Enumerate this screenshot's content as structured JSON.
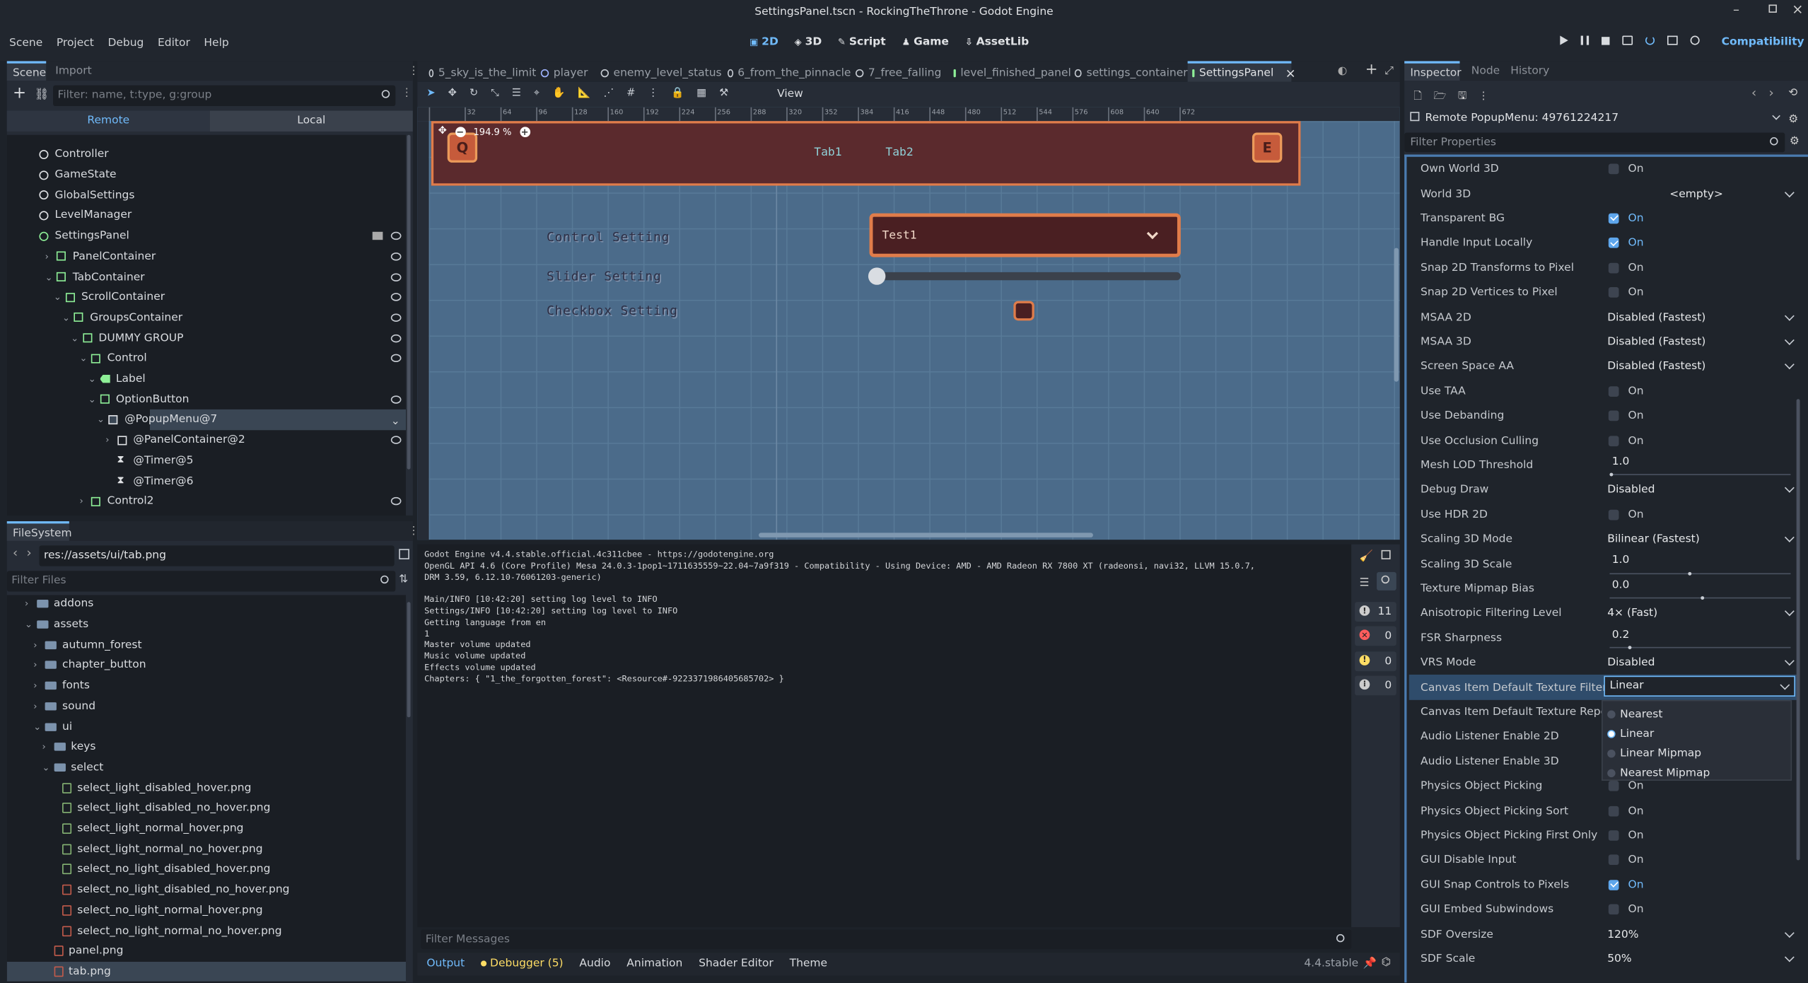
{
  "window": {
    "title": "SettingsPanel.tscn - RockingTheThrone - Godot Engine"
  },
  "menu": [
    "Scene",
    "Project",
    "Debug",
    "Editor",
    "Help"
  ],
  "workspaces": [
    "2D",
    "3D",
    "Script",
    "Game",
    "AssetLib"
  ],
  "renderer": "Compatibility",
  "scene_dock": {
    "tabs": [
      "Scene",
      "Import"
    ],
    "filter_placeholder": "Filter: name, t:type, g:group",
    "remote_local": [
      "Remote",
      "Local"
    ],
    "nodes": [
      {
        "label": "Controller",
        "indent": 1
      },
      {
        "label": "GameState",
        "indent": 1
      },
      {
        "label": "GlobalSettings",
        "indent": 1
      },
      {
        "label": "LevelManager",
        "indent": 1
      },
      {
        "label": "SettingsPanel",
        "indent": 1
      },
      {
        "label": "PanelContainer",
        "indent": 2
      },
      {
        "label": "TabContainer",
        "indent": 2
      },
      {
        "label": "ScrollContainer",
        "indent": 3
      },
      {
        "label": "GroupsContainer",
        "indent": 4
      },
      {
        "label": "DUMMY GROUP",
        "indent": 5
      },
      {
        "label": "Control",
        "indent": 6
      },
      {
        "label": "Label",
        "indent": 7
      },
      {
        "label": "OptionButton",
        "indent": 7
      },
      {
        "label": "@PopupMenu@7",
        "indent": 8
      },
      {
        "label": "@PanelContainer@2",
        "indent": 9
      },
      {
        "label": "@Timer@5",
        "indent": 9
      },
      {
        "label": "@Timer@6",
        "indent": 9
      },
      {
        "label": "Control2",
        "indent": 6
      }
    ]
  },
  "filesystem": {
    "tab": "FileSystem",
    "path": "res://assets/ui/tab.png",
    "filter_placeholder": "Filter Files",
    "items": [
      {
        "label": "addons",
        "type": "folder",
        "indent": 1
      },
      {
        "label": "assets",
        "type": "folder",
        "indent": 1
      },
      {
        "label": "autumn_forest",
        "type": "folder",
        "indent": 2
      },
      {
        "label": "chapter_button",
        "type": "folder",
        "indent": 2
      },
      {
        "label": "fonts",
        "type": "folder",
        "indent": 2
      },
      {
        "label": "sound",
        "type": "folder",
        "indent": 2
      },
      {
        "label": "ui",
        "type": "folder",
        "indent": 2
      },
      {
        "label": "keys",
        "type": "folder",
        "indent": 3
      },
      {
        "label": "select",
        "type": "folder",
        "indent": 3
      },
      {
        "label": "select_light_disabled_hover.png",
        "type": "file",
        "indent": 4
      },
      {
        "label": "select_light_disabled_no_hover.png",
        "type": "file",
        "indent": 4
      },
      {
        "label": "select_light_normal_hover.png",
        "type": "file",
        "indent": 4
      },
      {
        "label": "select_light_normal_no_hover.png",
        "type": "file",
        "indent": 4
      },
      {
        "label": "select_no_light_disabled_hover.png",
        "type": "file",
        "indent": 4
      },
      {
        "label": "select_no_light_disabled_no_hover.png",
        "type": "file-red",
        "indent": 4
      },
      {
        "label": "select_no_light_normal_hover.png",
        "type": "file-red",
        "indent": 4
      },
      {
        "label": "select_no_light_normal_no_hover.png",
        "type": "file-red",
        "indent": 4
      },
      {
        "label": "panel.png",
        "type": "file-red",
        "indent": 3
      },
      {
        "label": "tab.png",
        "type": "file-red",
        "indent": 3
      }
    ]
  },
  "scene_tabs": [
    "5_sky_is_the_limit",
    "player",
    "enemy_level_status",
    "6_from_the_pinnacle",
    "7_free_falling",
    "level_finished_panel",
    "settings_container",
    "SettingsPanel"
  ],
  "viewport": {
    "view_label": "View",
    "zoom": "194.9 %",
    "ruler": [
      "-",
      "32",
      "64",
      "96",
      "128",
      "160",
      "192",
      "224",
      "256",
      "288",
      "320",
      "352",
      "384",
      "416",
      "448",
      "480",
      "512",
      "544",
      "576",
      "608",
      "640",
      "672"
    ],
    "tabs": [
      "Tab1",
      "Tab2"
    ],
    "key_left": "Q",
    "key_right": "E",
    "settings": [
      "Control Setting",
      "Slider Setting",
      "Checkbox Setting"
    ],
    "option_value": "Test1"
  },
  "console": {
    "lines": [
      "Godot Engine v4.4.stable.official.4c311cbee - https://godotengine.org",
      "OpenGL API 4.6 (Core Profile) Mesa 24.0.3-1pop1~1711635559~22.04~7a9f319 - Compatibility - Using Device: AMD - AMD Radeon RX 7800 XT (radeonsi, navi32, LLVM 15.0.7,",
      "DRM 3.59, 6.12.10-76061203-generic)",
      "",
      "Main/INFO [10:42:20] setting log level to INFO",
      "Settings/INFO [10:42:20] setting log level to INFO",
      "Getting language from en",
      "1",
      "Master volume updated",
      "Music volume updated",
      "Effects volume updated",
      "Chapters: { \"1_the_forgotten_forest\": <Resource#-9223371986405685702> }"
    ],
    "counts": [
      "11",
      "0",
      "0",
      "0"
    ],
    "filter_placeholder": "Filter Messages"
  },
  "bottom_tabs": [
    "Output",
    "Debugger (5)",
    "Audio",
    "Animation",
    "Shader Editor",
    "Theme"
  ],
  "version": "4.4.stable",
  "inspector": {
    "tabs": [
      "Inspector",
      "Node",
      "History"
    ],
    "object": "Remote PopupMenu: 49761224217",
    "filter_placeholder": "Filter Properties",
    "props": [
      {
        "label": "Own World 3D",
        "kind": "check",
        "on": false,
        "value": "On"
      },
      {
        "label": "World 3D",
        "kind": "res",
        "value": "<empty>"
      },
      {
        "label": "Transparent BG",
        "kind": "check",
        "on": true,
        "value": "On"
      },
      {
        "label": "Handle Input Locally",
        "kind": "check",
        "on": true,
        "value": "On"
      },
      {
        "label": "Snap 2D Transforms to Pixel",
        "kind": "check",
        "on": false,
        "value": "On"
      },
      {
        "label": "Snap 2D Vertices to Pixel",
        "kind": "check",
        "on": false,
        "value": "On"
      },
      {
        "label": "MSAA 2D",
        "kind": "dd",
        "value": "Disabled (Fastest)"
      },
      {
        "label": "MSAA 3D",
        "kind": "dd",
        "value": "Disabled (Fastest)"
      },
      {
        "label": "Screen Space AA",
        "kind": "dd",
        "value": "Disabled (Fastest)"
      },
      {
        "label": "Use TAA",
        "kind": "check",
        "on": false,
        "value": "On"
      },
      {
        "label": "Use Debanding",
        "kind": "check",
        "on": false,
        "value": "On"
      },
      {
        "label": "Use Occlusion Culling",
        "kind": "check",
        "on": false,
        "value": "On"
      },
      {
        "label": "Mesh LOD Threshold",
        "kind": "slider",
        "value": "1.0",
        "fill": 0.0
      },
      {
        "label": "Debug Draw",
        "kind": "dd",
        "value": "Disabled"
      },
      {
        "label": "Use HDR 2D",
        "kind": "check",
        "on": false,
        "value": "On"
      },
      {
        "label": "Scaling 3D Mode",
        "kind": "dd",
        "value": "Bilinear (Fastest)"
      },
      {
        "label": "Scaling 3D Scale",
        "kind": "slider",
        "value": "1.0",
        "fill": 0.43
      },
      {
        "label": "Texture Mipmap Bias",
        "kind": "slider",
        "value": "0.0",
        "fill": 0.5
      },
      {
        "label": "Anisotropic Filtering Level",
        "kind": "dd",
        "value": "4× (Fast)"
      },
      {
        "label": "FSR Sharpness",
        "kind": "slider",
        "value": "0.2",
        "fill": 0.1
      },
      {
        "label": "VRS Mode",
        "kind": "dd",
        "value": "Disabled"
      },
      {
        "label": "Canvas Item Default Texture Filter",
        "kind": "dd-open",
        "value": "Linear"
      },
      {
        "label": "Canvas Item Default Texture Repeat",
        "kind": "blank",
        "value": ""
      },
      {
        "label": "Audio Listener Enable 2D",
        "kind": "blank",
        "value": ""
      },
      {
        "label": "Audio Listener Enable 3D",
        "kind": "blank",
        "value": ""
      },
      {
        "label": "Physics Object Picking",
        "kind": "check",
        "on": false,
        "value": "On"
      },
      {
        "label": "Physics Object Picking Sort",
        "kind": "check",
        "on": false,
        "value": "On"
      },
      {
        "label": "Physics Object Picking First Only",
        "kind": "check",
        "on": false,
        "value": "On"
      },
      {
        "label": "GUI Disable Input",
        "kind": "check",
        "on": false,
        "value": "On"
      },
      {
        "label": "GUI Snap Controls to Pixels",
        "kind": "check",
        "on": true,
        "value": "On"
      },
      {
        "label": "GUI Embed Subwindows",
        "kind": "check",
        "on": false,
        "value": "On"
      },
      {
        "label": "SDF Oversize",
        "kind": "dd",
        "value": "120%"
      },
      {
        "label": "SDF Scale",
        "kind": "dd",
        "value": "50%"
      }
    ],
    "filter_options": [
      "Nearest",
      "Linear",
      "Linear Mipmap",
      "Nearest Mipmap"
    ],
    "filter_selected": "Linear"
  }
}
